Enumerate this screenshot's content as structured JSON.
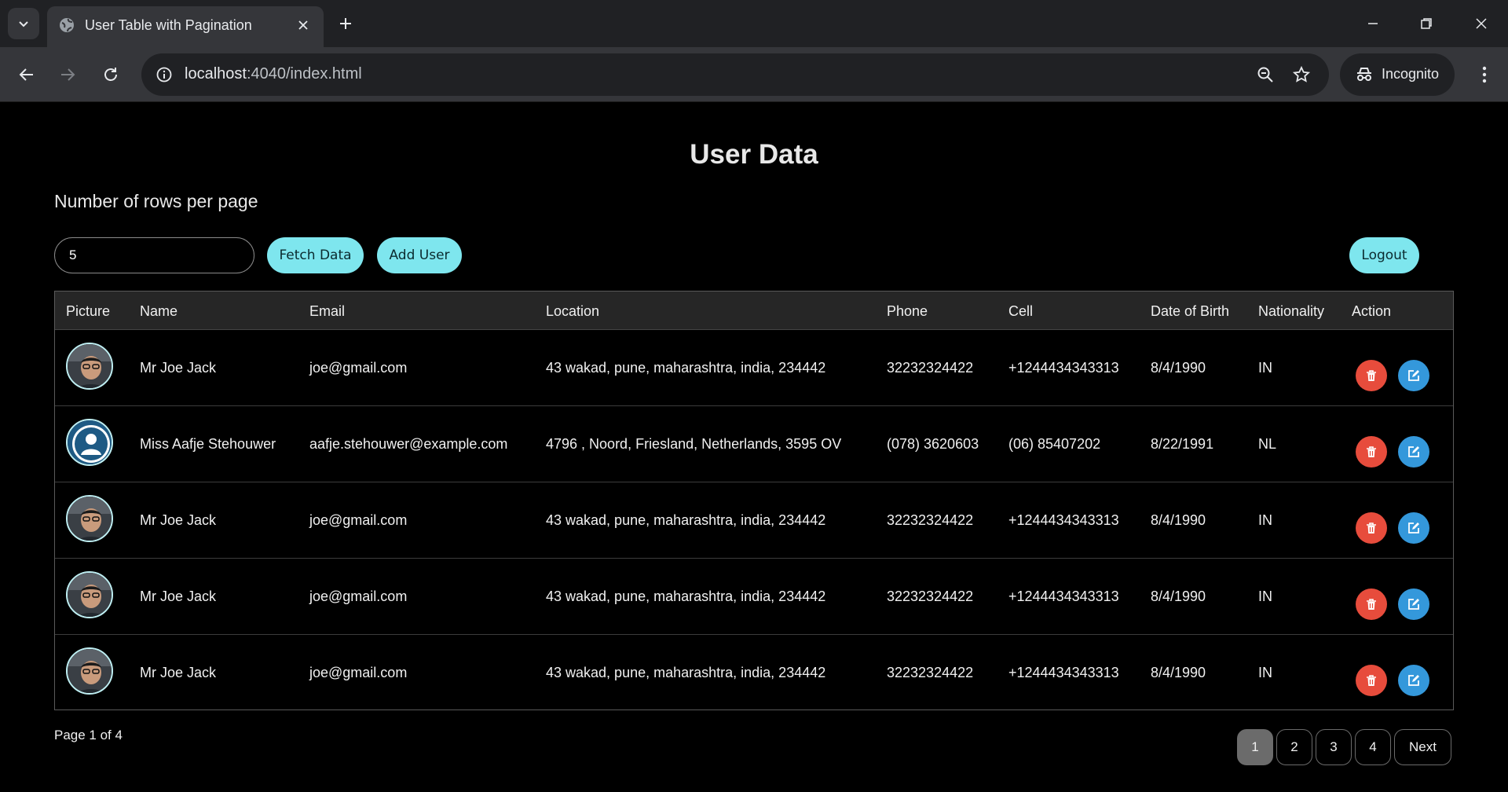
{
  "browser": {
    "tab_title": "User Table with Pagination",
    "url_host": "localhost",
    "url_path": ":4040/index.html",
    "incognito_label": "Incognito"
  },
  "page": {
    "heading": "User Data",
    "rows_label": "Number of rows per page",
    "rows_value": "5",
    "fetch_label": "Fetch Data",
    "add_label": "Add User",
    "logout_label": "Logout",
    "accent_color": "#7ee6ee",
    "delete_color": "#e74c3c",
    "edit_color": "#3498db"
  },
  "table": {
    "headers": [
      "Picture",
      "Name",
      "Email",
      "Location",
      "Phone",
      "Cell",
      "Date of Birth",
      "Nationality",
      "Action"
    ],
    "rows": [
      {
        "picture": "photo-avatar",
        "name": "Mr Joe Jack",
        "email": "joe@gmail.com",
        "location": "43 wakad, pune, maharashtra, india, 234442",
        "phone": "32232324422",
        "cell": "+1244434343313",
        "dob": "8/4/1990",
        "nat": "IN"
      },
      {
        "picture": "default-user-avatar",
        "name": "Miss Aafje Stehouwer",
        "email": "aafje.stehouwer@example.com",
        "location": "4796 , Noord, Friesland, Netherlands, 3595 OV",
        "phone": "(078) 3620603",
        "cell": "(06) 85407202",
        "dob": "8/22/1991",
        "nat": "NL"
      },
      {
        "picture": "photo-avatar",
        "name": "Mr Joe Jack",
        "email": "joe@gmail.com",
        "location": "43 wakad, pune, maharashtra, india, 234442",
        "phone": "32232324422",
        "cell": "+1244434343313",
        "dob": "8/4/1990",
        "nat": "IN"
      },
      {
        "picture": "photo-avatar",
        "name": "Mr Joe Jack",
        "email": "joe@gmail.com",
        "location": "43 wakad, pune, maharashtra, india, 234442",
        "phone": "32232324422",
        "cell": "+1244434343313",
        "dob": "8/4/1990",
        "nat": "IN"
      },
      {
        "picture": "photo-avatar",
        "name": "Mr Joe Jack",
        "email": "joe@gmail.com",
        "location": "43 wakad, pune, maharashtra, india, 234442",
        "phone": "32232324422",
        "cell": "+1244434343313",
        "dob": "8/4/1990",
        "nat": "IN"
      }
    ]
  },
  "pagination": {
    "info": "Page 1 of 4",
    "pages": [
      "1",
      "2",
      "3",
      "4"
    ],
    "active_page": "1",
    "next_label": "Next"
  }
}
